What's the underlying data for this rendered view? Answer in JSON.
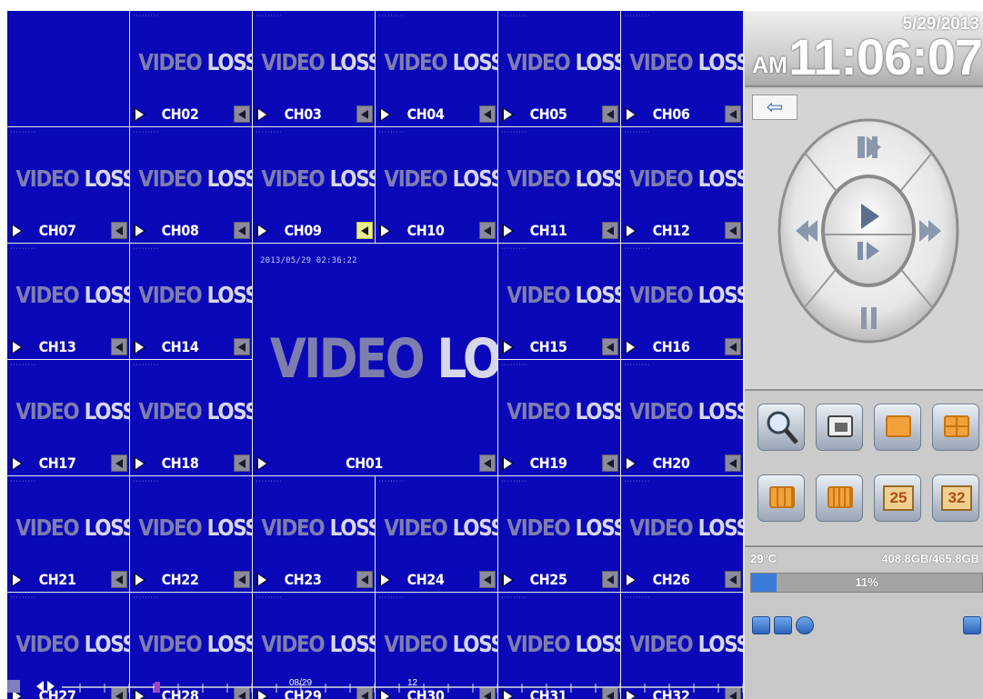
{
  "clock": {
    "date": "5/29/2013",
    "ampm": "AM",
    "time": "11:06:07"
  },
  "main_channel": {
    "label": "CH01",
    "timestamp": "2013/05/29 02:36:22",
    "video_loss": {
      "word1": "VIDEO",
      "word2": "LOSS"
    }
  },
  "video_loss": {
    "word1": "VIDEO",
    "word2": "LOSS"
  },
  "channels": [
    "CH02",
    "CH03",
    "CH04",
    "CH05",
    "CH06",
    "CH07",
    "CH08",
    "CH09",
    "CH10",
    "CH11",
    "CH12",
    "CH13",
    "CH14",
    "CH15",
    "CH16",
    "CH17",
    "CH18",
    "CH19",
    "CH20",
    "CH21",
    "CH22",
    "CH23",
    "CH24",
    "CH25",
    "CH26",
    "CH27",
    "CH28",
    "CH29",
    "CH30",
    "CH31",
    "CH32"
  ],
  "active_audio_channel": "CH09",
  "status": {
    "temperature": "29°C",
    "disk": "408.8GB/465.8GB",
    "progress_label": "11%",
    "progress": 0.11
  },
  "playback": {
    "back_icon": "arrow-left-icon",
    "icons": [
      "play-pause-icon",
      "rewind-icon",
      "play-icon",
      "forward-icon",
      "step-icon",
      "pause-icon"
    ]
  },
  "toolbar": {
    "icons": [
      "search-icon",
      "pip-icon",
      "single-screen-icon",
      "quad-screen-icon",
      "nine-screen-icon",
      "sixteen-screen-icon"
    ],
    "layout_25": "25",
    "layout_32": "32"
  },
  "timeline": {
    "labels": [
      "08/29",
      "12"
    ]
  },
  "colors": {
    "tile": "#0a08b8",
    "panel": "#c9c9c9",
    "progress": "#3a7bd8"
  }
}
